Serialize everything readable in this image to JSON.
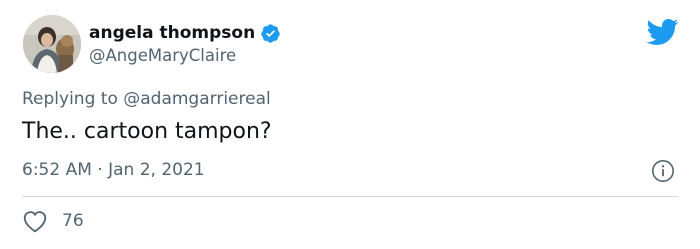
{
  "author": {
    "display_name": "angela thompson",
    "handle": "@AngeMaryClaire",
    "verified": true
  },
  "reply": {
    "prefix": "Replying to ",
    "mention": "@adamgarriereal"
  },
  "text": "The.. cartoon tampon?",
  "meta": {
    "timestamp": "6:52 AM · Jan 2, 2021"
  },
  "actions": {
    "like_count": "76"
  },
  "colors": {
    "brand_blue": "#1d9bf0",
    "text_primary": "#0f1419",
    "text_secondary": "#536471",
    "divider": "#cfd9de"
  },
  "icons": {
    "logo": "twitter-bird-icon",
    "verified": "verified-badge-icon",
    "info": "info-icon",
    "like": "heart-icon"
  }
}
